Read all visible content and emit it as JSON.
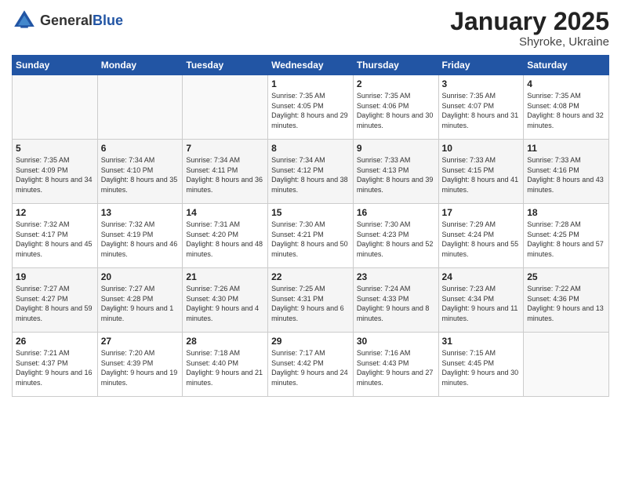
{
  "header": {
    "logo_general": "General",
    "logo_blue": "Blue",
    "month": "January 2025",
    "location": "Shyroke, Ukraine"
  },
  "weekdays": [
    "Sunday",
    "Monday",
    "Tuesday",
    "Wednesday",
    "Thursday",
    "Friday",
    "Saturday"
  ],
  "weeks": [
    [
      {
        "day": "",
        "info": ""
      },
      {
        "day": "",
        "info": ""
      },
      {
        "day": "",
        "info": ""
      },
      {
        "day": "1",
        "info": "Sunrise: 7:35 AM\nSunset: 4:05 PM\nDaylight: 8 hours\nand 29 minutes."
      },
      {
        "day": "2",
        "info": "Sunrise: 7:35 AM\nSunset: 4:06 PM\nDaylight: 8 hours\nand 30 minutes."
      },
      {
        "day": "3",
        "info": "Sunrise: 7:35 AM\nSunset: 4:07 PM\nDaylight: 8 hours\nand 31 minutes."
      },
      {
        "day": "4",
        "info": "Sunrise: 7:35 AM\nSunset: 4:08 PM\nDaylight: 8 hours\nand 32 minutes."
      }
    ],
    [
      {
        "day": "5",
        "info": "Sunrise: 7:35 AM\nSunset: 4:09 PM\nDaylight: 8 hours\nand 34 minutes."
      },
      {
        "day": "6",
        "info": "Sunrise: 7:34 AM\nSunset: 4:10 PM\nDaylight: 8 hours\nand 35 minutes."
      },
      {
        "day": "7",
        "info": "Sunrise: 7:34 AM\nSunset: 4:11 PM\nDaylight: 8 hours\nand 36 minutes."
      },
      {
        "day": "8",
        "info": "Sunrise: 7:34 AM\nSunset: 4:12 PM\nDaylight: 8 hours\nand 38 minutes."
      },
      {
        "day": "9",
        "info": "Sunrise: 7:33 AM\nSunset: 4:13 PM\nDaylight: 8 hours\nand 39 minutes."
      },
      {
        "day": "10",
        "info": "Sunrise: 7:33 AM\nSunset: 4:15 PM\nDaylight: 8 hours\nand 41 minutes."
      },
      {
        "day": "11",
        "info": "Sunrise: 7:33 AM\nSunset: 4:16 PM\nDaylight: 8 hours\nand 43 minutes."
      }
    ],
    [
      {
        "day": "12",
        "info": "Sunrise: 7:32 AM\nSunset: 4:17 PM\nDaylight: 8 hours\nand 45 minutes."
      },
      {
        "day": "13",
        "info": "Sunrise: 7:32 AM\nSunset: 4:19 PM\nDaylight: 8 hours\nand 46 minutes."
      },
      {
        "day": "14",
        "info": "Sunrise: 7:31 AM\nSunset: 4:20 PM\nDaylight: 8 hours\nand 48 minutes."
      },
      {
        "day": "15",
        "info": "Sunrise: 7:30 AM\nSunset: 4:21 PM\nDaylight: 8 hours\nand 50 minutes."
      },
      {
        "day": "16",
        "info": "Sunrise: 7:30 AM\nSunset: 4:23 PM\nDaylight: 8 hours\nand 52 minutes."
      },
      {
        "day": "17",
        "info": "Sunrise: 7:29 AM\nSunset: 4:24 PM\nDaylight: 8 hours\nand 55 minutes."
      },
      {
        "day": "18",
        "info": "Sunrise: 7:28 AM\nSunset: 4:25 PM\nDaylight: 8 hours\nand 57 minutes."
      }
    ],
    [
      {
        "day": "19",
        "info": "Sunrise: 7:27 AM\nSunset: 4:27 PM\nDaylight: 8 hours\nand 59 minutes."
      },
      {
        "day": "20",
        "info": "Sunrise: 7:27 AM\nSunset: 4:28 PM\nDaylight: 9 hours\nand 1 minute."
      },
      {
        "day": "21",
        "info": "Sunrise: 7:26 AM\nSunset: 4:30 PM\nDaylight: 9 hours\nand 4 minutes."
      },
      {
        "day": "22",
        "info": "Sunrise: 7:25 AM\nSunset: 4:31 PM\nDaylight: 9 hours\nand 6 minutes."
      },
      {
        "day": "23",
        "info": "Sunrise: 7:24 AM\nSunset: 4:33 PM\nDaylight: 9 hours\nand 8 minutes."
      },
      {
        "day": "24",
        "info": "Sunrise: 7:23 AM\nSunset: 4:34 PM\nDaylight: 9 hours\nand 11 minutes."
      },
      {
        "day": "25",
        "info": "Sunrise: 7:22 AM\nSunset: 4:36 PM\nDaylight: 9 hours\nand 13 minutes."
      }
    ],
    [
      {
        "day": "26",
        "info": "Sunrise: 7:21 AM\nSunset: 4:37 PM\nDaylight: 9 hours\nand 16 minutes."
      },
      {
        "day": "27",
        "info": "Sunrise: 7:20 AM\nSunset: 4:39 PM\nDaylight: 9 hours\nand 19 minutes."
      },
      {
        "day": "28",
        "info": "Sunrise: 7:18 AM\nSunset: 4:40 PM\nDaylight: 9 hours\nand 21 minutes."
      },
      {
        "day": "29",
        "info": "Sunrise: 7:17 AM\nSunset: 4:42 PM\nDaylight: 9 hours\nand 24 minutes."
      },
      {
        "day": "30",
        "info": "Sunrise: 7:16 AM\nSunset: 4:43 PM\nDaylight: 9 hours\nand 27 minutes."
      },
      {
        "day": "31",
        "info": "Sunrise: 7:15 AM\nSunset: 4:45 PM\nDaylight: 9 hours\nand 30 minutes."
      },
      {
        "day": "",
        "info": ""
      }
    ]
  ]
}
